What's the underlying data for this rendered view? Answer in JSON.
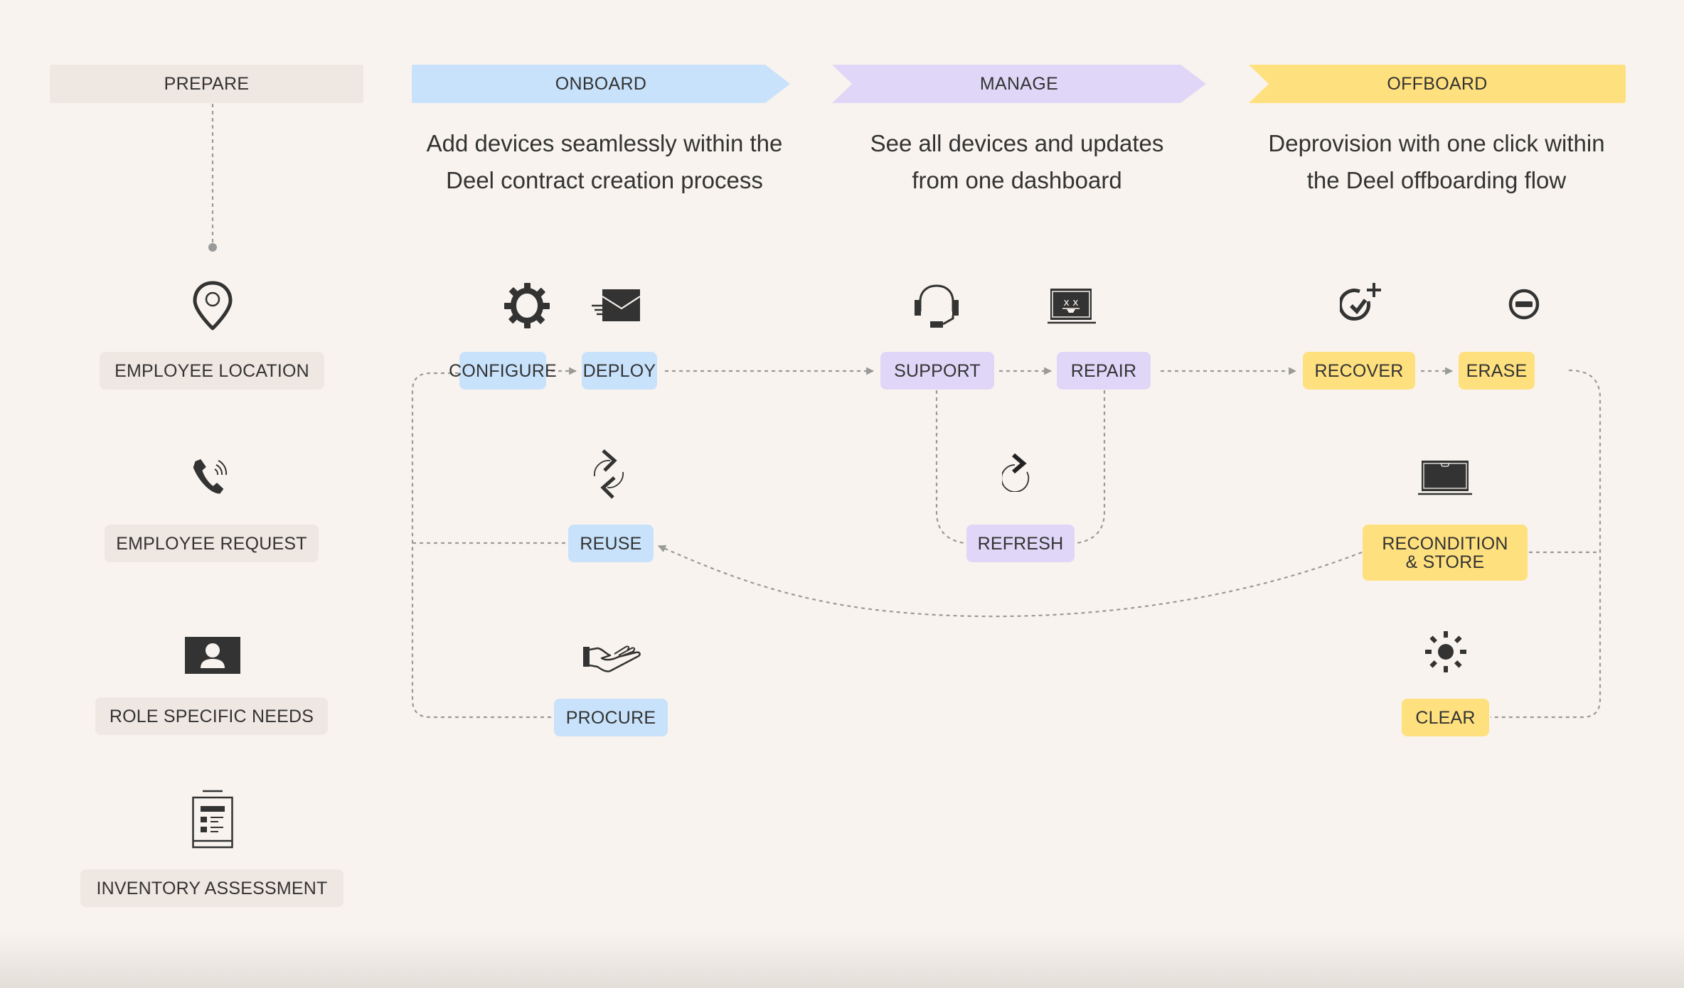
{
  "colors": {
    "background": "#F8F3EE",
    "prepare": "#EFE7E2",
    "onboard": "#C8E2FC",
    "manage": "#E0D7F8",
    "offboard": "#FFE07E",
    "text": "#333333",
    "connector": "#9A9A9A"
  },
  "phases": {
    "prepare": {
      "label": "PREPARE"
    },
    "onboard": {
      "label": "ONBOARD",
      "description_line1": "Add devices seamlessly within the",
      "description_line2": "Deel contract creation process"
    },
    "manage": {
      "label": "MANAGE",
      "description_line1": "See all devices and updates",
      "description_line2": "from one dashboard"
    },
    "offboard": {
      "label": "OFFBOARD",
      "description_line1": "Deprovision with one click within",
      "description_line2": "the Deel offboarding flow"
    }
  },
  "prepare_steps": [
    {
      "label": "EMPLOYEE LOCATION",
      "icon": "location-pin-icon"
    },
    {
      "label": "EMPLOYEE REQUEST",
      "icon": "phone-ringing-icon"
    },
    {
      "label": "ROLE SPECIFIC NEEDS",
      "icon": "person-card-icon"
    },
    {
      "label": "INVENTORY ASSESSMENT",
      "icon": "clipboard-checklist-icon"
    }
  ],
  "onboard_steps": {
    "configure": {
      "label": "CONFIGURE",
      "icon": "gear-icon"
    },
    "deploy": {
      "label": "DEPLOY",
      "icon": "send-mail-icon"
    },
    "reuse": {
      "label": "REUSE",
      "icon": "swap-arrows-icon"
    },
    "procure": {
      "label": "PROCURE",
      "icon": "open-hand-icon"
    }
  },
  "manage_steps": {
    "support": {
      "label": "SUPPORT",
      "icon": "headset-icon"
    },
    "repair": {
      "label": "REPAIR",
      "icon": "broken-laptop-icon"
    },
    "refresh": {
      "label": "REFRESH",
      "icon": "refresh-arrow-icon"
    }
  },
  "offboard_steps": {
    "recover": {
      "label": "RECOVER",
      "icon": "check-plus-icon"
    },
    "erase": {
      "label": "ERASE",
      "icon": "minus-circle-icon"
    },
    "recondition": {
      "label_line1": "RECONDITION",
      "label_line2": "& STORE",
      "icon": "laptop-icon"
    },
    "clear": {
      "label": "CLEAR",
      "icon": "sun-icon"
    }
  },
  "flows": [
    {
      "from": "PREPARE",
      "to": "EMPLOYEE LOCATION"
    },
    {
      "from": "CONFIGURE",
      "to": "DEPLOY"
    },
    {
      "from": "DEPLOY",
      "to": "SUPPORT"
    },
    {
      "from": "SUPPORT",
      "to": "REPAIR"
    },
    {
      "from": "SUPPORT",
      "to": "REFRESH"
    },
    {
      "from": "REPAIR",
      "to": "REFRESH"
    },
    {
      "from": "REPAIR",
      "to": "RECOVER"
    },
    {
      "from": "RECOVER",
      "to": "ERASE"
    },
    {
      "from": "ERASE",
      "to": "CLEAR"
    },
    {
      "from": "RECONDITION & STORE",
      "to": "REUSE"
    },
    {
      "from": "PROCURE",
      "to": "CONFIGURE"
    },
    {
      "from": "REUSE",
      "to": "CONFIGURE"
    }
  ]
}
